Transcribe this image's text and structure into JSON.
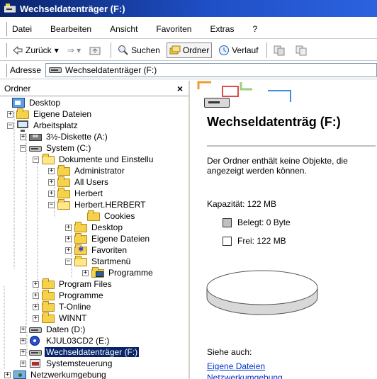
{
  "window": {
    "title": "Wechseldatenträger (F:)"
  },
  "menubar": {
    "items": [
      "Datei",
      "Bearbeiten",
      "Ansicht",
      "Favoriten",
      "Extras",
      "?"
    ]
  },
  "toolbar": {
    "back_label": "Zurück",
    "back_arrow": "▾",
    "forward_arrow": "⇒ ▾",
    "search_label": "Suchen",
    "folders_label": "Ordner",
    "history_label": "Verlauf"
  },
  "address": {
    "label": "Adresse",
    "value": "Wechseldatenträger (F:)"
  },
  "folders_pane": {
    "header": "Ordner",
    "close_glyph": "×",
    "tree": [
      {
        "label": "Desktop",
        "icon": "desktop-icon",
        "expander": ""
      },
      {
        "label": "Eigene Dateien",
        "icon": "folder-icon",
        "expander": "+"
      },
      {
        "label": "Arbeitsplatz",
        "icon": "computer-icon",
        "expander": "−"
      },
      {
        "label": "3½-Diskette (A:)",
        "icon": "floppy-icon",
        "expander": "+"
      },
      {
        "label": "System (C:)",
        "icon": "drive-icon",
        "expander": "−"
      },
      {
        "label": "Dokumente und Einstellu",
        "icon": "folder-open-icon",
        "expander": "−"
      },
      {
        "label": "Administrator",
        "icon": "folder-icon",
        "expander": "+"
      },
      {
        "label": "All Users",
        "icon": "folder-icon",
        "expander": "+"
      },
      {
        "label": "Herbert",
        "icon": "folder-icon",
        "expander": "+"
      },
      {
        "label": "Herbert.HERBERT",
        "icon": "folder-open-icon",
        "expander": "−"
      },
      {
        "label": "Cookies",
        "icon": "folder-icon",
        "expander": ""
      },
      {
        "label": "Desktop",
        "icon": "folder-icon",
        "expander": "+"
      },
      {
        "label": "Eigene Dateien",
        "icon": "folder-icon",
        "expander": "+"
      },
      {
        "label": "Favoriten",
        "icon": "favorites-folder-icon",
        "expander": "+"
      },
      {
        "label": "Startmenü",
        "icon": "folder-open-icon",
        "expander": "−"
      },
      {
        "label": "Programme",
        "icon": "programs-folder-icon",
        "expander": "+"
      },
      {
        "label": "Program Files",
        "icon": "folder-icon",
        "expander": "+"
      },
      {
        "label": "Programme",
        "icon": "folder-icon",
        "expander": "+"
      },
      {
        "label": "T-Online",
        "icon": "folder-icon",
        "expander": "+"
      },
      {
        "label": "WINNT",
        "icon": "folder-icon",
        "expander": "+"
      },
      {
        "label": "Daten (D:)",
        "icon": "drive-icon",
        "expander": "+"
      },
      {
        "label": "KJUL03CD2 (E:)",
        "icon": "cd-drive-icon",
        "expander": "+"
      },
      {
        "label": "Wechseldatenträger (F:)",
        "icon": "removable-drive-icon",
        "expander": "+",
        "selected": true
      },
      {
        "label": "Systemsteuerung",
        "icon": "control-panel-icon",
        "expander": "+"
      },
      {
        "label": "Netzwerkumgebung",
        "icon": "network-icon",
        "expander": "+"
      }
    ]
  },
  "details_pane": {
    "title": "Wechseldatenträg (F:)",
    "description": "Der Ordner enthält keine Objekte, die angezeigt werden können.",
    "capacity": "Kapazität: 122 MB",
    "used": "Belegt: 0 Byte",
    "free": "Frei: 122 MB",
    "used_color": "#c0c0c0",
    "free_color": "#ffffff",
    "see_also": "Siehe auch:",
    "links": [
      "Eigene Dateien",
      "Netzwerkumgebung"
    ]
  },
  "colors": {
    "titlebar": "#0a246a",
    "selection": "#0a246a",
    "link": "#0033cc",
    "folder": "#f5d24a"
  }
}
